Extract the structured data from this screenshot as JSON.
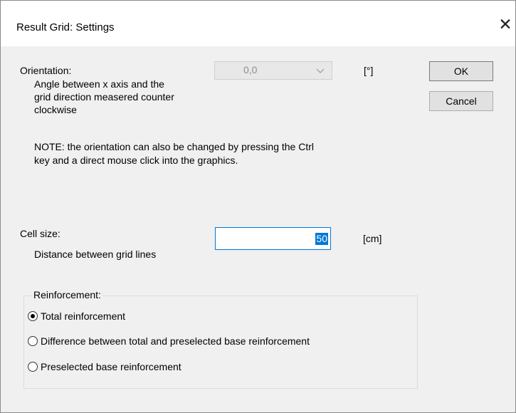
{
  "dialog": {
    "title": "Result Grid: Settings",
    "close_glyph": "✕"
  },
  "orientation": {
    "label": "Orientation:",
    "description_lines": [
      "Angle between x axis and the",
      "grid direction measered counter",
      "clockwise"
    ],
    "value": "0,0",
    "unit": "[°]",
    "note_lines": [
      "NOTE: the orientation can also be changed by pressing the Ctrl",
      "key and a direct mouse click into the graphics."
    ]
  },
  "cell_size": {
    "label": "Cell size:",
    "description": "Distance between grid lines",
    "value": "50",
    "unit": "[cm]"
  },
  "reinforcement": {
    "title": "Reinforcement:",
    "options": [
      {
        "label": "Total reinforcement",
        "selected": true
      },
      {
        "label": "Difference between total and preselected base reinforcement",
        "selected": false
      },
      {
        "label": "Preselected base reinforcement",
        "selected": false
      }
    ]
  },
  "buttons": {
    "ok": "OK",
    "cancel": "Cancel"
  }
}
